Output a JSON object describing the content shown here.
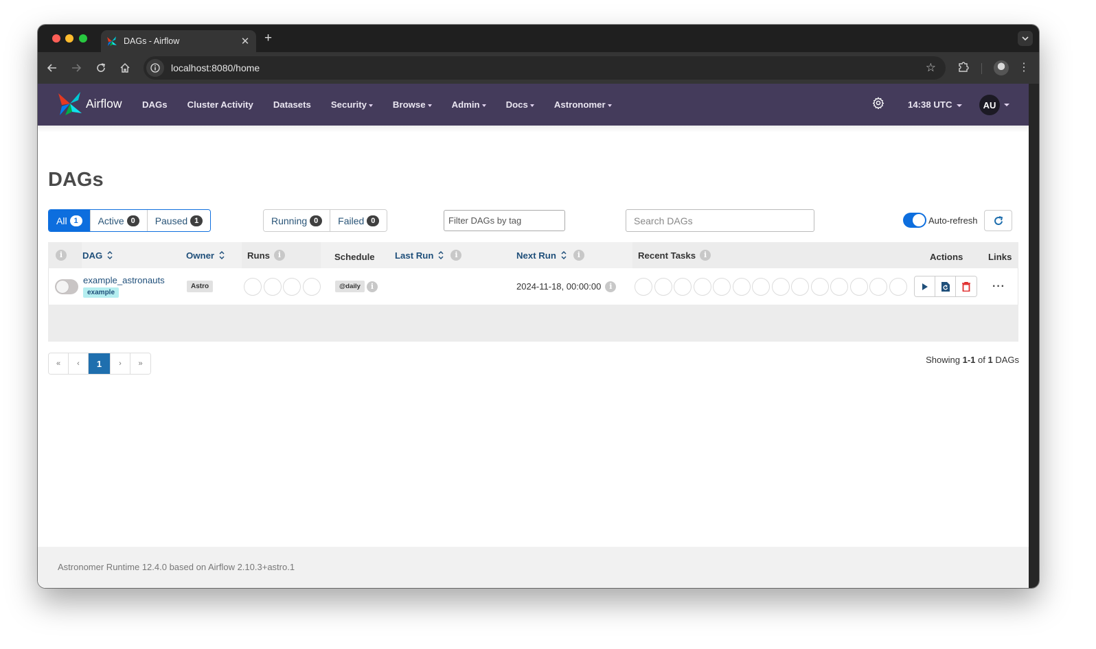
{
  "browser": {
    "tab_title": "DAGs - Airflow",
    "new_tab_label": "+",
    "url": "localhost:8080/home"
  },
  "navbar": {
    "brand": "Airflow",
    "links": [
      {
        "label": "DAGs",
        "dropdown": false
      },
      {
        "label": "Cluster Activity",
        "dropdown": false
      },
      {
        "label": "Datasets",
        "dropdown": false
      },
      {
        "label": "Security",
        "dropdown": true
      },
      {
        "label": "Browse",
        "dropdown": true
      },
      {
        "label": "Admin",
        "dropdown": true
      },
      {
        "label": "Docs",
        "dropdown": true
      },
      {
        "label": "Astronomer",
        "dropdown": true
      }
    ],
    "time": "14:38 UTC",
    "user_initials": "AU",
    "bar_color": "#443b5b"
  },
  "page": {
    "title": "DAGs"
  },
  "filters": {
    "status_group": [
      {
        "label": "All",
        "count": "1",
        "active": true
      },
      {
        "label": "Active",
        "count": "0",
        "active": false
      },
      {
        "label": "Paused",
        "count": "1",
        "active": false
      }
    ],
    "run_group": [
      {
        "label": "Running",
        "count": "0"
      },
      {
        "label": "Failed",
        "count": "0"
      }
    ],
    "tag_placeholder": "Filter DAGs by tag",
    "search_placeholder": "Search DAGs",
    "auto_refresh_label": "Auto-refresh",
    "auto_refresh_on": true,
    "accent": "#0d6ede"
  },
  "table": {
    "headers": {
      "dag": "DAG",
      "owner": "Owner",
      "runs": "Runs",
      "schedule": "Schedule",
      "last_run": "Last Run",
      "next_run": "Next Run",
      "recent_tasks": "Recent Tasks",
      "actions": "Actions",
      "links": "Links"
    },
    "rows": [
      {
        "paused": true,
        "dag_id": "example_astronauts",
        "tags": [
          "example"
        ],
        "owner": "Astro",
        "runs_circles": 4,
        "schedule": "@daily",
        "last_run": "",
        "next_run": "2024-11-18, 00:00:00",
        "recent_task_circles": 14,
        "links_label": "···"
      }
    ]
  },
  "pagination": {
    "first": "«",
    "prev": "‹",
    "current": "1",
    "next": "›",
    "last": "»",
    "showing_prefix": "Showing ",
    "showing_range": "1-1",
    "showing_of": " of ",
    "showing_total": "1",
    "showing_suffix": " DAGs"
  },
  "footer": {
    "text": "Astronomer Runtime 12.4.0 based on Airflow 2.10.3+astro.1"
  }
}
